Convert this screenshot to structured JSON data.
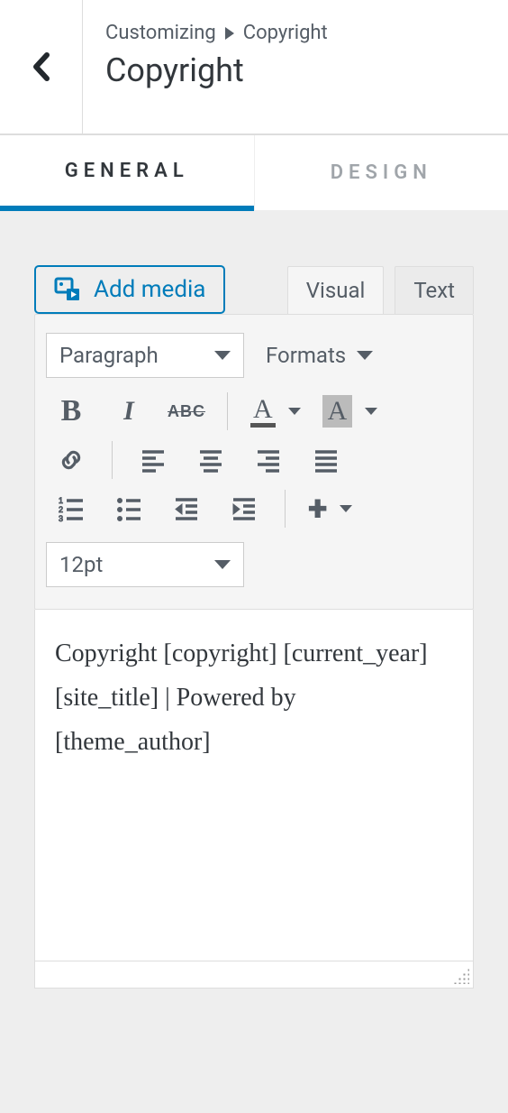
{
  "header": {
    "breadcrumb_root": "Customizing",
    "breadcrumb_current": "Copyright",
    "title": "Copyright"
  },
  "tabs": {
    "general": "GENERAL",
    "design": "DESIGN"
  },
  "editor": {
    "add_media_label": "Add media",
    "mode_visual": "Visual",
    "mode_text": "Text",
    "paragraph_select": "Paragraph",
    "formats_select": "Formats",
    "strike_label": "ABC",
    "text_color_label": "A",
    "bg_color_label": "A",
    "font_size": "12pt",
    "content": "Copyright [copyright] [current_year] [site_title] | Powered by [theme_author]"
  },
  "colors": {
    "accent": "#007cba"
  }
}
